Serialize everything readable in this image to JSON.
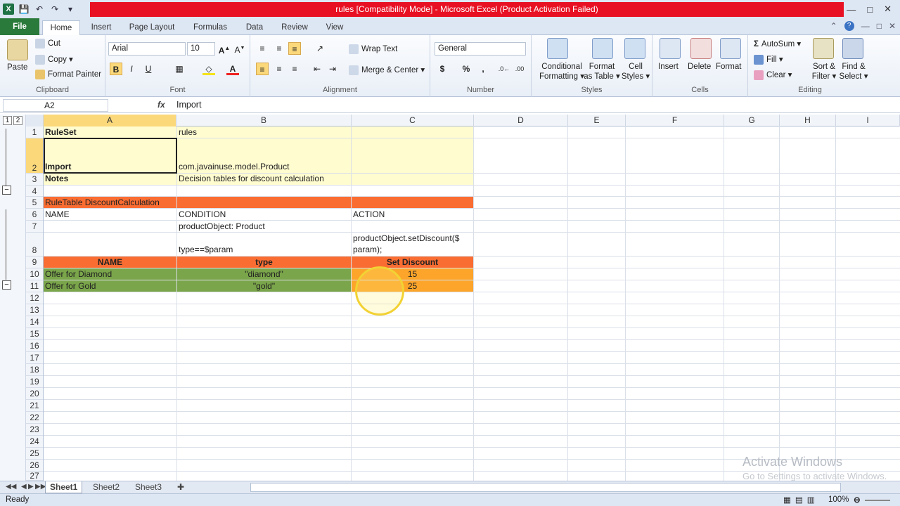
{
  "window": {
    "title": "rules  [Compatibility Mode]  -  Microsoft Excel (Product Activation Failed)",
    "title_bar_color": "#e81123"
  },
  "tabs": {
    "file": "File",
    "home": "Home",
    "insert": "Insert",
    "page_layout": "Page Layout",
    "formulas": "Formulas",
    "data": "Data",
    "review": "Review",
    "view": "View"
  },
  "ribbon": {
    "clipboard": {
      "label": "Clipboard",
      "paste": "Paste",
      "cut": "Cut",
      "copy": "Copy",
      "format_painter": "Format Painter"
    },
    "font": {
      "label": "Font",
      "font_name": "Arial",
      "font_size": "10",
      "bold": "B",
      "italic": "I",
      "underline": "U"
    },
    "alignment": {
      "label": "Alignment",
      "wrap_text": "Wrap Text",
      "merge_center": "Merge & Center"
    },
    "number": {
      "label": "Number",
      "format": "General",
      "currency": "$",
      "percent": "%",
      "comma": ","
    },
    "styles": {
      "label": "Styles",
      "conditional": "Conditional",
      "conditional2": "Formatting",
      "format_as": "Format",
      "format_as2": "as Table",
      "cell_styles": "Cell",
      "cell_styles2": "Styles"
    },
    "cells": {
      "label": "Cells",
      "insert": "Insert",
      "delete": "Delete",
      "format": "Format"
    },
    "editing": {
      "label": "Editing",
      "autosum": "AutoSum",
      "fill": "Fill",
      "clear": "Clear",
      "sort": "Sort &",
      "sort2": "Filter",
      "find": "Find &",
      "find2": "Select"
    }
  },
  "formula_bar": {
    "name_box": "A2",
    "fx": "fx",
    "value": "Import"
  },
  "outline_levels": [
    "1",
    "2"
  ],
  "columns": [
    "A",
    "B",
    "C",
    "D",
    "E",
    "F",
    "G",
    "H",
    "I"
  ],
  "rows": [
    "1",
    "2",
    "3",
    "4",
    "5",
    "6",
    "7",
    "8",
    "9",
    "10",
    "11",
    "12",
    "13",
    "14",
    "15",
    "16",
    "17",
    "18",
    "19",
    "20",
    "21",
    "22",
    "23",
    "24",
    "25",
    "26",
    "27"
  ],
  "cells": {
    "a1": "RuleSet",
    "b1": "rules",
    "a2": "Import",
    "b2": "com.javainuse.model.Product",
    "a3": "Notes",
    "b3": "Decision tables for discount calculation",
    "a5": "RuleTable DiscountCalculation",
    "a6": "NAME",
    "b6": "CONDITION",
    "c6": "ACTION",
    "b7": "productObject: Product",
    "b8": "type==$param",
    "c8a": "productObject.setDiscount($",
    "c8b": "param);",
    "a9": "NAME",
    "b9": "type",
    "c9": "Set Discount",
    "a10": "Offer for Diamond",
    "b10": "\"diamond\"",
    "c10": "15",
    "a11": "Offer for Gold",
    "b11": "\"gold\"",
    "c11": "25"
  },
  "colors": {
    "yellow": "#fffcd0",
    "orange_red": "#fa6d32",
    "green": "#7aa54a",
    "orange": "#fda52a"
  },
  "sheets": [
    "Sheet1",
    "Sheet2",
    "Sheet3"
  ],
  "status": {
    "ready": "Ready",
    "zoom": "100%"
  },
  "watermark": {
    "line1": "Activate Windows",
    "line2": "Go to Settings to activate Windows."
  }
}
